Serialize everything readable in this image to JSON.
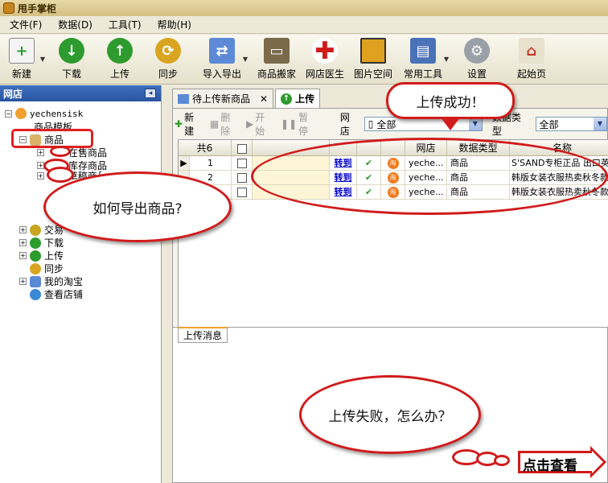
{
  "title": "甩手掌柜",
  "menu": [
    "文件(F)",
    "数据(D)",
    "工具(T)",
    "帮助(H)"
  ],
  "toolbar": {
    "new": "新建",
    "download": "下载",
    "upload": "上传",
    "sync": "同步",
    "import_export": "导入导出",
    "product_move": "商品搬家",
    "shop_doctor": "网店医生",
    "image_space": "图片空间",
    "common_tools": "常用工具",
    "settings": "设置",
    "start_page": "起始页"
  },
  "sidebar": {
    "header": "网店",
    "account": "yechensisk",
    "items": {
      "product_template": "商品模板",
      "products": "商品",
      "on_sale": "在售商品",
      "warehouse": "库存商品",
      "draft": "草稿商品",
      "trade": "交易",
      "download": "下载",
      "upload": "上传",
      "sync": "同步",
      "my_taobao": "我的淘宝",
      "view_shop": "查看店铺"
    }
  },
  "tabs": {
    "pending": "待上传新商品",
    "upload": "上传"
  },
  "subbar": {
    "new": "新建",
    "delete": "删除",
    "start": "开始",
    "pause": "暂停",
    "shop_label": "网店",
    "shop_value": "全部",
    "type_label": "数据类型",
    "type_value": "全部"
  },
  "grid": {
    "count": "共6",
    "headers": {
      "shop": "网店",
      "type": "数据类型",
      "name": "名称"
    },
    "rows": [
      {
        "index": "1",
        "link": "转到",
        "shop": "yeche...",
        "type": "商品",
        "name": "S'SAND专柜正品 出口英"
      },
      {
        "index": "2",
        "link": "转到",
        "shop": "yeche...",
        "type": "商品",
        "name": "韩版女装衣服热卖秋冬款"
      },
      {
        "index": "3",
        "link": "转到",
        "shop": "yeche...",
        "type": "商品",
        "name": "韩版女装衣服热卖秋冬款"
      }
    ]
  },
  "bottom_tab": "上传消息",
  "bubbles": {
    "success": "上传成功！",
    "export": "如何导出商品?",
    "failure": "上传失败，怎么办？",
    "cta": "点击查看"
  },
  "colors": {
    "accent_red": "#d11b1b",
    "sidebar_head": "#2855a0"
  }
}
